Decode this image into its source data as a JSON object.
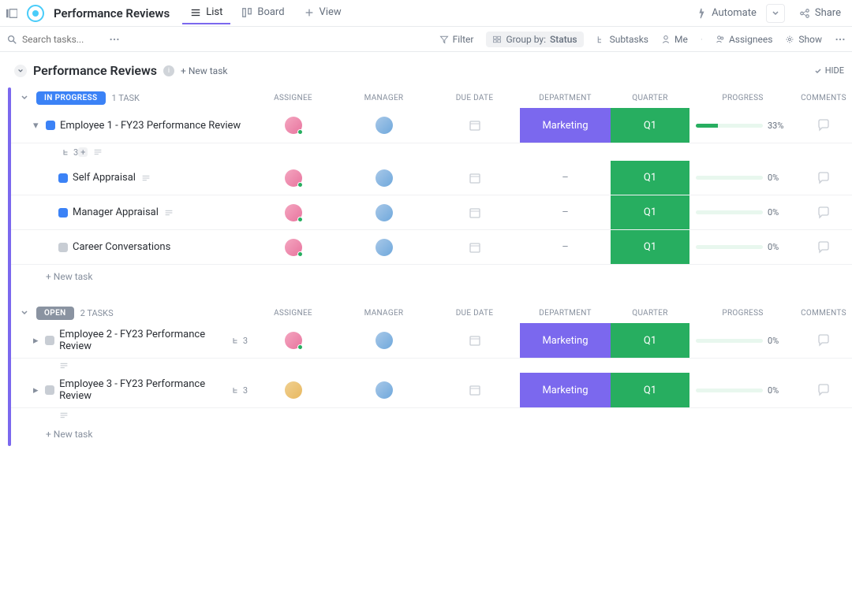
{
  "topbar": {
    "title": "Performance Reviews",
    "tabs": {
      "list": "List",
      "board": "Board",
      "view": "View"
    },
    "automate": "Automate",
    "share": "Share"
  },
  "toolbar": {
    "search_placeholder": "Search tasks...",
    "filter": "Filter",
    "group_by_label": "Group by:",
    "group_by_value": "Status",
    "subtasks": "Subtasks",
    "me": "Me",
    "assignees": "Assignees",
    "show": "Show"
  },
  "group": {
    "title": "Performance Reviews",
    "new_task": "+ New task",
    "hide": "HIDE"
  },
  "columns": {
    "assignee": "ASSIGNEE",
    "manager": "MANAGER",
    "due_date": "DUE DATE",
    "department": "DEPARTMENT",
    "quarter": "QUARTER",
    "progress": "PROGRESS",
    "comments": "COMMENTS"
  },
  "status": {
    "in_progress": {
      "label": "IN PROGRESS",
      "count": "1 TASK"
    },
    "open": {
      "label": "OPEN",
      "count": "2 TASKS"
    }
  },
  "tasks": {
    "t1": {
      "name": "Employee 1 - FY23 Performance Review",
      "subtask_count": "3",
      "department": "Marketing",
      "quarter": "Q1",
      "progress_pct": "33%",
      "progress_fill": 33
    },
    "t1a": {
      "name": "Self Appraisal",
      "department": "–",
      "quarter": "Q1",
      "progress_pct": "0%",
      "progress_fill": 0
    },
    "t1b": {
      "name": "Manager Appraisal",
      "department": "–",
      "quarter": "Q1",
      "progress_pct": "0%",
      "progress_fill": 0
    },
    "t1c": {
      "name": "Career Conversations",
      "department": "–",
      "quarter": "Q1",
      "progress_pct": "0%",
      "progress_fill": 0
    },
    "t2": {
      "name": "Employee 2 - FY23 Performance Review",
      "subtask_count": "3",
      "department": "Marketing",
      "quarter": "Q1",
      "progress_pct": "0%",
      "progress_fill": 0
    },
    "t3": {
      "name": "Employee 3 - FY23 Performance Review",
      "subtask_count": "3",
      "department": "Marketing",
      "quarter": "Q1",
      "progress_pct": "0%",
      "progress_fill": 0
    }
  },
  "add_row": {
    "new_task": "+ New task"
  }
}
